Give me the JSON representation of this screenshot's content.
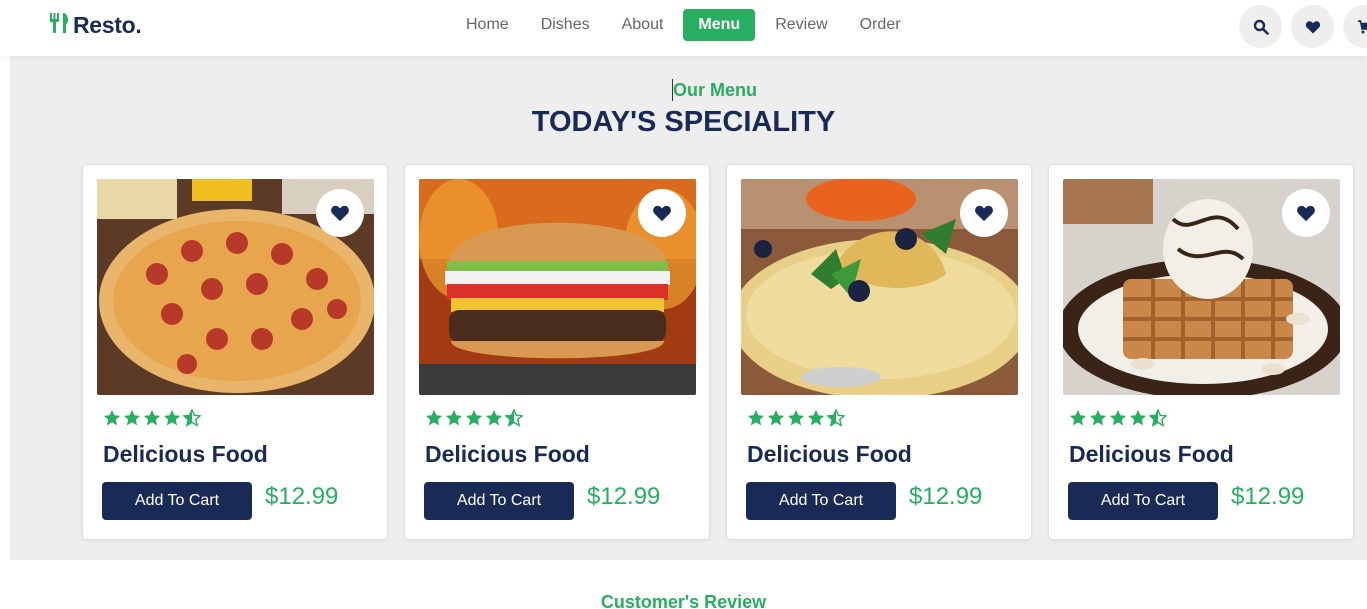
{
  "brand": {
    "name": "Resto."
  },
  "nav": {
    "items": [
      {
        "label": "Home",
        "active": false
      },
      {
        "label": "Dishes",
        "active": false
      },
      {
        "label": "About",
        "active": false
      },
      {
        "label": "Menu",
        "active": true
      },
      {
        "label": "Review",
        "active": false
      },
      {
        "label": "Order",
        "active": false
      }
    ]
  },
  "header_icons": [
    "search-icon",
    "heart-icon",
    "cart-icon"
  ],
  "menu": {
    "subheading": "Our Menu",
    "heading": "TODAY'S SPECIALITY",
    "cards": [
      {
        "image": "pizza",
        "rating": 4.5,
        "title": "Delicious Food",
        "button": "Add To Cart",
        "price": "$12.99"
      },
      {
        "image": "burger",
        "rating": 4.5,
        "title": "Delicious Food",
        "button": "Add To Cart",
        "price": "$12.99"
      },
      {
        "image": "crepes",
        "rating": 4.5,
        "title": "Delicious Food",
        "button": "Add To Cart",
        "price": "$12.99"
      },
      {
        "image": "waffle-ice-cream",
        "rating": 4.5,
        "title": "Delicious Food",
        "button": "Add To Cart",
        "price": "$12.99"
      }
    ]
  },
  "review": {
    "subheading": "Customer's Review"
  },
  "colors": {
    "accent": "#27ae60",
    "dark": "#192a56",
    "section_bg": "#eeeeee"
  }
}
